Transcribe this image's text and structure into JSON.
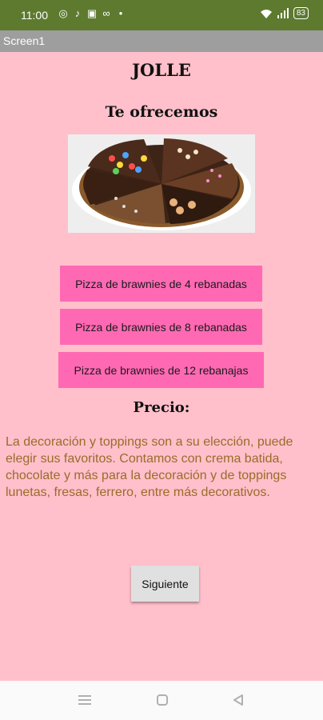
{
  "status_bar": {
    "time": "11:00",
    "notification_icons": [
      "whatsapp-icon",
      "tiktok-icon",
      "instagram-icon",
      "link-icon",
      "dot-icon"
    ],
    "battery": "83"
  },
  "title_bar": {
    "title": "Screen1"
  },
  "main": {
    "title": "JOLLE",
    "subtitle": "Te ofrecemos",
    "options": [
      "Pizza de brawnies de 4 rebanadas",
      "Pizza de brawnies de 8 rebanadas",
      "Pizza de brawnies de 12 rebanajas"
    ],
    "price_heading": "Precio:",
    "description": "La decoración y toppings son a su elección, puede elegir sus favoritos. Contamos con crema batida, chocolate y más para la decoración y de toppings lunetas, fresas, ferrero, entre más decorativos.",
    "next_label": "Siguiente"
  },
  "colors": {
    "status_bar": "#5d7a2f",
    "title_bar": "#9e9e9e",
    "background": "#ffc0cb",
    "button": "#ff69b4",
    "description_text": "#9b6b2a"
  }
}
